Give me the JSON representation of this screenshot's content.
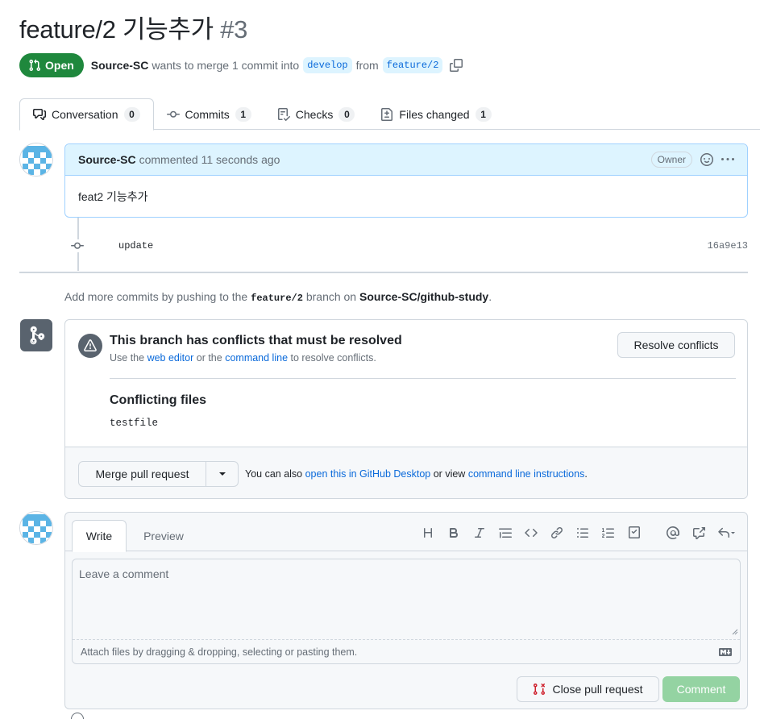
{
  "pr": {
    "title": "feature/2 기능추가",
    "number": "#3",
    "state": "Open",
    "author": "Source-SC",
    "merge_text": "wants to merge 1 commit into",
    "base_branch": "develop",
    "from_text": "from",
    "head_branch": "feature/2"
  },
  "tabs": [
    {
      "label": "Conversation",
      "count": "0",
      "icon": "comment-discussion-icon"
    },
    {
      "label": "Commits",
      "count": "1",
      "icon": "git-commit-icon"
    },
    {
      "label": "Checks",
      "count": "0",
      "icon": "checklist-icon"
    },
    {
      "label": "Files changed",
      "count": "1",
      "icon": "file-diff-icon"
    }
  ],
  "comment": {
    "author": "Source-SC",
    "meta": "commented 11 seconds ago",
    "role": "Owner",
    "body": "feat2 기능추가"
  },
  "commit": {
    "message": "update",
    "sha": "16a9e13"
  },
  "hint": {
    "prefix": "Add more commits by pushing to the",
    "branch": "feature/2",
    "middle": "branch on",
    "repo": "Source-SC/github-study",
    "suffix": "."
  },
  "merge": {
    "conflict_title": "This branch has conflicts that must be resolved",
    "sub_prefix": "Use the",
    "web_editor": "web editor",
    "sub_or": "or the",
    "command_line": "command line",
    "sub_suffix": "to resolve conflicts.",
    "resolve_button": "Resolve conflicts",
    "conflicting_files_title": "Conflicting files",
    "files": [
      "testfile"
    ],
    "merge_button": "Merge pull request",
    "also_prefix": "You can also",
    "desktop_link": "open this in GitHub Desktop",
    "also_or": "or view",
    "instructions_link": "command line instructions",
    "also_suffix": "."
  },
  "editor": {
    "write_tab": "Write",
    "preview_tab": "Preview",
    "placeholder": "Leave a comment",
    "attach_text": "Attach files by dragging & dropping, selecting or pasting them.",
    "close_button": "Close pull request",
    "comment_button": "Comment",
    "toolbar": [
      "heading-icon",
      "bold-icon",
      "italic-icon",
      "quote-icon",
      "code-icon",
      "link-icon",
      "unordered-list-icon",
      "ordered-list-icon",
      "task-list-icon",
      "mention-icon",
      "cross-reference-icon",
      "reply-icon"
    ]
  },
  "colors": {
    "open_green": "#1f883d",
    "link_blue": "#0969da",
    "branch_bg": "#ddf4ff",
    "comment_header_bg": "#ddf4ff",
    "comment_btn_disabled": "#94d3a2",
    "close_red": "#cf222e"
  }
}
